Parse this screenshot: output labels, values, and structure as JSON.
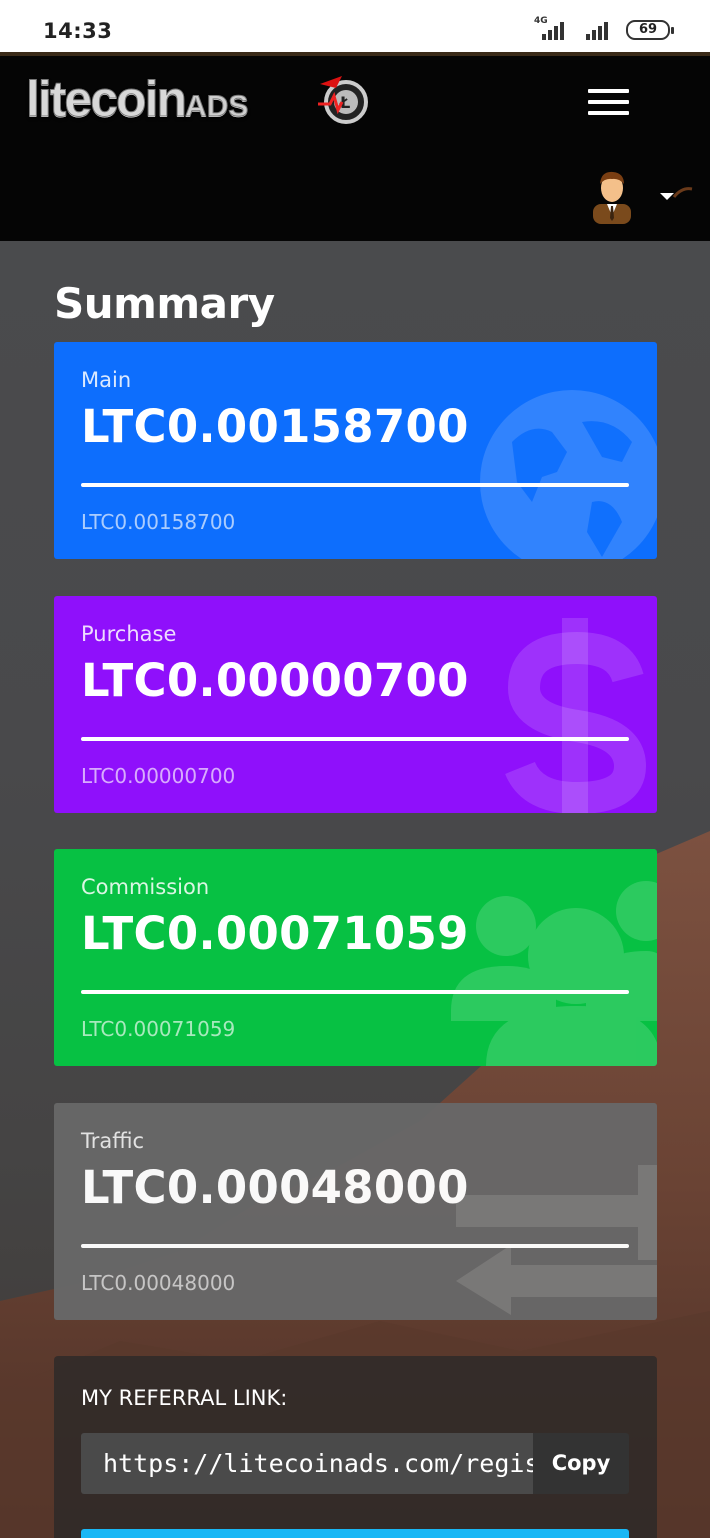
{
  "status_bar": {
    "time": "14:33",
    "network_type": "4G",
    "battery_level": "69"
  },
  "header": {
    "logo_text": "litecoin",
    "logo_suffix": "ADS",
    "menu_icon": "hamburger-icon",
    "avatar_icon": "user-avatar-icon"
  },
  "summary": {
    "title": "Summary",
    "cards": [
      {
        "label": "Main",
        "amount": "LTC0.00158700",
        "sub": "LTC0.00158700",
        "color": "#0d6efd",
        "icon": "globe-icon",
        "progress": 1.0
      },
      {
        "label": "Purchase",
        "amount": "LTC0.00000700",
        "sub": "LTC0.00000700",
        "color": "#8f10fb",
        "icon": "dollar-icon",
        "progress": 1.0
      },
      {
        "label": "Commission",
        "amount": "LTC0.00071059",
        "sub": "LTC0.00071059",
        "color": "#07c143",
        "icon": "users-icon",
        "progress": 1.0
      },
      {
        "label": "Traffic",
        "amount": "LTC0.00048000",
        "sub": "LTC0.00048000",
        "color": "#686868",
        "icon": "exchange-arrows-icon",
        "progress": 1.0
      }
    ]
  },
  "referral": {
    "label": "MY REFERRAL LINK:",
    "link": "https://litecoinads.com/regis",
    "copy_label": "Copy"
  },
  "colors": {
    "header_bg": "#050505",
    "referral_button": "#19b7f5"
  }
}
